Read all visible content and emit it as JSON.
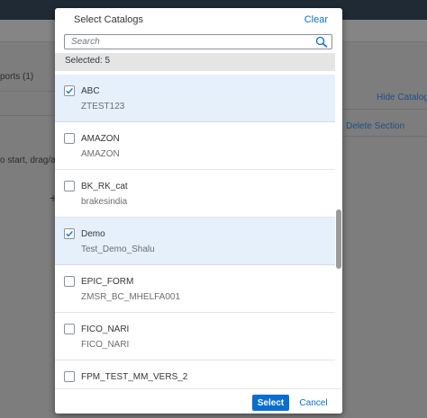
{
  "background": {
    "left_text_1": "ports (1)",
    "left_text_2": "o start, drag/ad",
    "right_link_1": "Hide Catalogs",
    "right_link_2": "Delete Section",
    "plus_glyph": "+"
  },
  "dialog": {
    "title": "Select Catalogs",
    "clear_label": "Clear",
    "search": {
      "placeholder": "Search",
      "value": ""
    },
    "selected_count_text": "Selected: 5",
    "items": [
      {
        "title": "ABC",
        "description": "ZTEST123",
        "checked": true
      },
      {
        "title": "AMAZON",
        "description": "AMAZON",
        "checked": false
      },
      {
        "title": "BK_RK_cat",
        "description": "brakesindia",
        "checked": false
      },
      {
        "title": "Demo",
        "description": "Test_Demo_Shalu",
        "checked": true
      },
      {
        "title": "EPIC_FORM",
        "description": "ZMSR_BC_MHELFA001",
        "checked": false
      },
      {
        "title": "FICO_NARI",
        "description": "FICO_NARI",
        "checked": false
      },
      {
        "title": "FPM_TEST_MM_VERS_2",
        "description": "",
        "checked": false
      }
    ],
    "select_label": "Select",
    "cancel_label": "Cancel"
  },
  "colors": {
    "accent": "#0a6ed1",
    "selected_row": "#e5f0fa",
    "shell_bar": "#1f2a35"
  },
  "icons": {
    "search": "search-icon",
    "check": "checkmark-icon"
  }
}
